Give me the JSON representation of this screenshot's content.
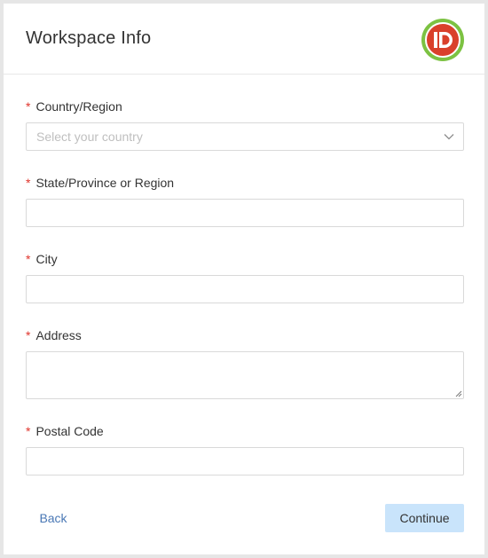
{
  "header": {
    "title": "Workspace Info",
    "logo_text": "iD",
    "logo_colors": {
      "ring": "#7cc242",
      "fill": "#d9402b"
    }
  },
  "form": {
    "required_mark": "*",
    "country": {
      "label": "Country/Region",
      "placeholder": "Select your country",
      "value": ""
    },
    "state": {
      "label": "State/Province or Region",
      "value": ""
    },
    "city": {
      "label": "City",
      "value": ""
    },
    "address": {
      "label": "Address",
      "value": ""
    },
    "postal": {
      "label": "Postal Code",
      "value": ""
    }
  },
  "actions": {
    "back_label": "Back",
    "continue_label": "Continue"
  },
  "colors": {
    "required": "#e0342c",
    "link": "#4a78b5",
    "primary_disabled_bg": "#c9e4fb"
  }
}
